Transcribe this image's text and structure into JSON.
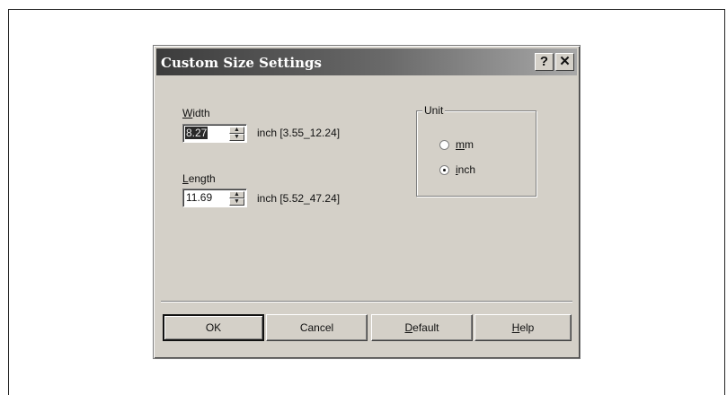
{
  "dialog": {
    "title": "Custom Size Settings",
    "help_glyph": "?",
    "close_glyph": "✕"
  },
  "width": {
    "label_accel": "W",
    "label_rest": "idth",
    "value": "8.27",
    "range": "inch [3.55_12.24]"
  },
  "length": {
    "label_accel": "L",
    "label_rest": "ength",
    "value": "11.69",
    "range": "inch [5.52_47.24]"
  },
  "unit": {
    "title": "Unit",
    "options": [
      {
        "accel": "m",
        "rest": "m",
        "selected": false
      },
      {
        "accel": "i",
        "rest": "nch",
        "selected": true
      }
    ]
  },
  "buttons": {
    "ok": "OK",
    "cancel": "Cancel",
    "default_accel": "D",
    "default_rest": "efault",
    "help_accel": "H",
    "help_rest": "elp"
  },
  "icons": {
    "spin_up": "▲",
    "spin_down": "▼"
  }
}
